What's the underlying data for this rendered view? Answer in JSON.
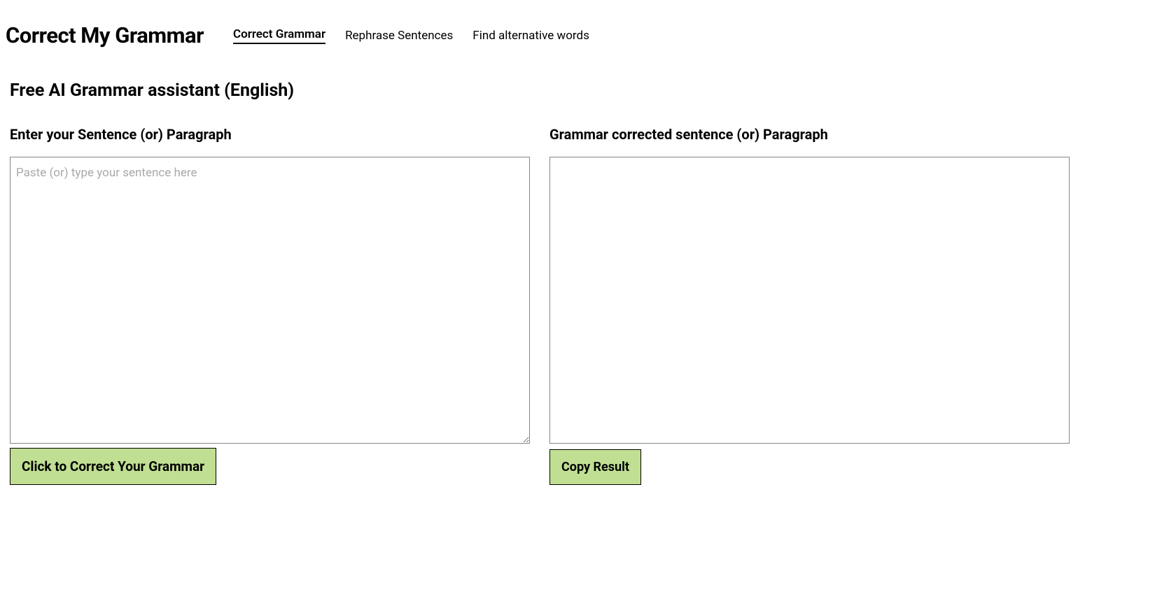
{
  "header": {
    "site_title": "Correct My Grammar",
    "nav": {
      "items": [
        {
          "label": "Correct Grammar",
          "active": true
        },
        {
          "label": "Rephrase Sentences",
          "active": false
        },
        {
          "label": "Find alternative words",
          "active": false
        }
      ]
    }
  },
  "page": {
    "heading": "Free AI Grammar assistant (English)"
  },
  "input_panel": {
    "label": "Enter your Sentence (or) Paragraph",
    "placeholder": "Paste (or) type your sentence here",
    "value": "",
    "button_label": "Click to Correct Your Grammar"
  },
  "output_panel": {
    "label": "Grammar corrected sentence (or) Paragraph",
    "value": "",
    "button_label": "Copy Result"
  }
}
